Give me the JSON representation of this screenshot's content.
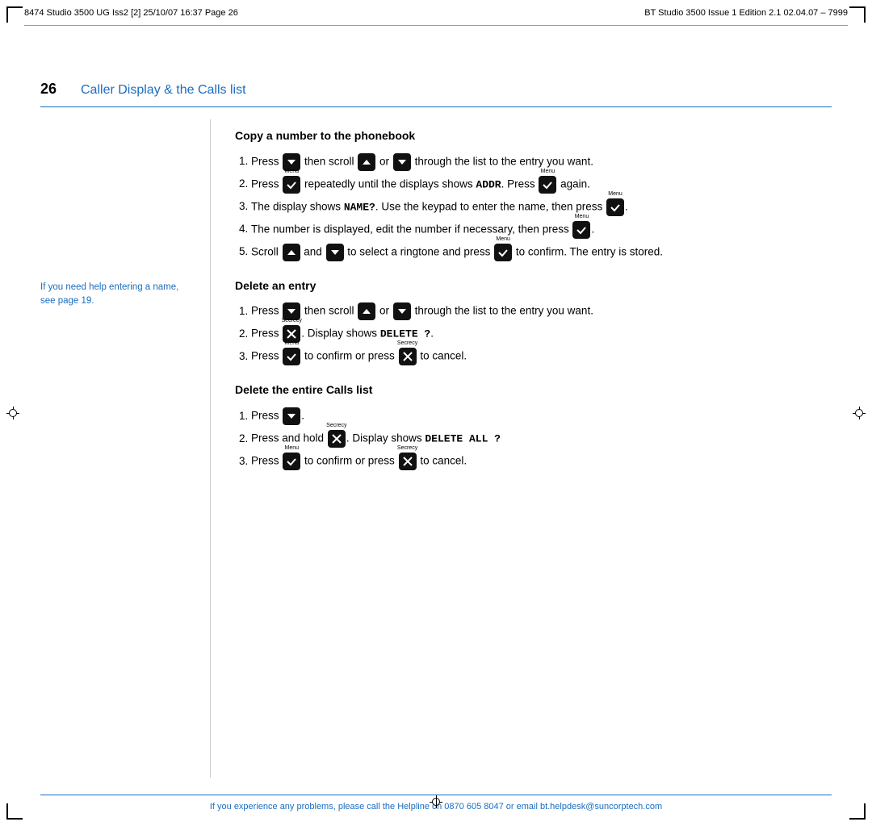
{
  "header": {
    "left_text": "8474 Studio 3500 UG Iss2 [2]  25/10/07  16:37  Page 26",
    "right_text": "BT Studio 3500  Issue 1  Edition 2.1  02.04.07 – 7999"
  },
  "page": {
    "number": "26",
    "title": "Caller Display & the Calls list"
  },
  "sidebar": {
    "note": "If you need help entering a name, see page 19."
  },
  "sections": [
    {
      "id": "copy_number",
      "title": "Copy a number to the phonebook",
      "steps": [
        {
          "id": 1,
          "parts": [
            "press_down",
            "scroll_up_or_down",
            "list_entry"
          ]
        },
        {
          "id": 2,
          "parts": [
            "press_menu_repeatedly",
            "displays_addr",
            "press_menu_again"
          ]
        },
        {
          "id": 3,
          "parts": [
            "display_shows_name",
            "keypad_enter_name",
            "press_menu"
          ]
        },
        {
          "id": 4,
          "parts": [
            "number_displayed",
            "edit_if_necessary",
            "press_menu"
          ]
        },
        {
          "id": 5,
          "parts": [
            "scroll_select_ringtone",
            "press_menu_confirm",
            "entry_stored"
          ]
        }
      ]
    },
    {
      "id": "delete_entry",
      "title": "Delete an entry",
      "steps": [
        {
          "id": 1,
          "text_before": "Press",
          "btn": "down",
          "text_after": "then scroll",
          "btn2": "up",
          "text_mid": "or",
          "btn3": "down",
          "text_end": "through the list to the entry you want."
        },
        {
          "id": 2,
          "text_before": "Press",
          "btn": "secrecy_x",
          "text_after": ". Display shows",
          "lcd": "DELETE ?"
        },
        {
          "id": 3,
          "text_before": "Press",
          "btn": "menu_check",
          "text_after": "to confirm or press",
          "btn2": "secrecy_x",
          "text_end": "to cancel."
        }
      ]
    },
    {
      "id": "delete_all",
      "title": "Delete the entire Calls list",
      "steps": [
        {
          "id": 1,
          "text": "Press",
          "btn": "down_simple"
        },
        {
          "id": 2,
          "text_before": "Press and hold",
          "btn": "secrecy_x",
          "text_after": ". Display shows",
          "lcd": "DELETE ALL ?"
        },
        {
          "id": 3,
          "text_before": "Press",
          "btn": "menu_check",
          "text_after": "to confirm or press",
          "btn2": "secrecy_x",
          "text_end": "to cancel."
        }
      ]
    }
  ],
  "footer": {
    "text": "If you experience any problems, please call the Helpline on 0870 605 8047 or email bt.helpdesk@suncorptech.com"
  }
}
